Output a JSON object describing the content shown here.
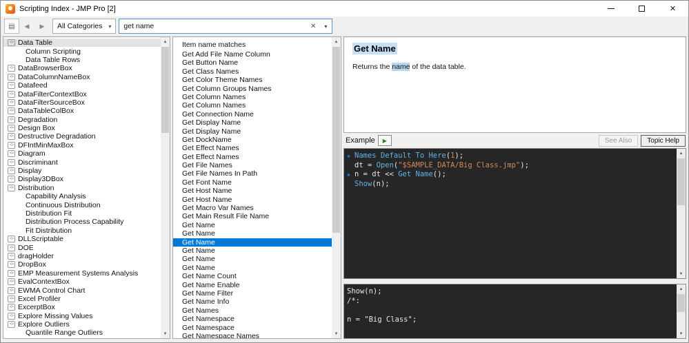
{
  "colors": {
    "selection": "#0078d7",
    "hl": "#b5d9f2",
    "hl-strong": "#c7e0f4",
    "code-bg": "#262626",
    "code-kw": "#5fb4ea",
    "code-str": "#d1885c",
    "code-num": "#d1885c",
    "marker": "#2f6fce"
  },
  "icons": {
    "up": "▲",
    "down": "▼",
    "back": "◀",
    "forward": "▶",
    "panel_toggle": "▤",
    "combo_arrow": "▾",
    "clear": "✕",
    "search_drop": "▾",
    "play": "▶",
    "tree_box": "<>",
    "marker": "◆",
    "close": "✕"
  },
  "window": {
    "title": "Scripting Index - JMP Pro [2]"
  },
  "toolbar": {
    "category_filter": {
      "value": "All Categories"
    },
    "search": {
      "value": "get name"
    }
  },
  "tree": {
    "items": [
      {
        "label": "Data Table",
        "icon": true,
        "indent": 0,
        "selected": true
      },
      {
        "label": "Column Scripting",
        "icon": false,
        "indent": 1
      },
      {
        "label": "Data Table Rows",
        "icon": false,
        "indent": 1
      },
      {
        "label": "DataBrowserBox",
        "icon": true,
        "indent": 0
      },
      {
        "label": "DataColumnNameBox",
        "icon": true,
        "indent": 0
      },
      {
        "label": "Datafeed",
        "icon": true,
        "indent": 0
      },
      {
        "label": "DataFilterContextBox",
        "icon": true,
        "indent": 0
      },
      {
        "label": "DataFilterSourceBox",
        "icon": true,
        "indent": 0
      },
      {
        "label": "DataTableColBox",
        "icon": true,
        "indent": 0
      },
      {
        "label": "Degradation",
        "icon": true,
        "indent": 0
      },
      {
        "label": "Design Box",
        "icon": true,
        "indent": 0
      },
      {
        "label": "Destructive Degradation",
        "icon": true,
        "indent": 0
      },
      {
        "label": "DFIntMinMaxBox",
        "icon": true,
        "indent": 0
      },
      {
        "label": "Diagram",
        "icon": true,
        "indent": 0
      },
      {
        "label": "Discriminant",
        "icon": true,
        "indent": 0
      },
      {
        "label": "Display",
        "icon": true,
        "indent": 0
      },
      {
        "label": "Display3DBox",
        "icon": true,
        "indent": 0
      },
      {
        "label": "Distribution",
        "icon": true,
        "indent": 0
      },
      {
        "label": "Capability Analysis",
        "icon": false,
        "indent": 1
      },
      {
        "label": "Continuous Distribution",
        "icon": false,
        "indent": 1
      },
      {
        "label": "Distribution Fit",
        "icon": false,
        "indent": 1
      },
      {
        "label": "Distribution Process Capability",
        "icon": false,
        "indent": 1
      },
      {
        "label": "Fit Distribution",
        "icon": false,
        "indent": 1
      },
      {
        "label": "DLLScriptable",
        "icon": true,
        "indent": 0
      },
      {
        "label": "DOE",
        "icon": true,
        "indent": 0
      },
      {
        "label": "dragHolder",
        "icon": true,
        "indent": 0
      },
      {
        "label": "DropBox",
        "icon": true,
        "indent": 0
      },
      {
        "label": "EMP Measurement Systems Analysis",
        "icon": true,
        "indent": 0
      },
      {
        "label": "EvalContextBox",
        "icon": true,
        "indent": 0
      },
      {
        "label": "EWMA Control Chart",
        "icon": true,
        "indent": 0
      },
      {
        "label": "Excel Profiler",
        "icon": true,
        "indent": 0
      },
      {
        "label": "ExcerptBox",
        "icon": true,
        "indent": 0
      },
      {
        "label": "Explore Missing Values",
        "icon": true,
        "indent": 0
      },
      {
        "label": "Explore Outliers",
        "icon": true,
        "indent": 0
      },
      {
        "label": "Quantile Range Outliers",
        "icon": false,
        "indent": 1
      }
    ]
  },
  "matches": {
    "header": "Item name matches",
    "selected_index": 22,
    "items": [
      "Get Add File Name Column",
      "Get Button Name",
      "Get Class Names",
      "Get Color Theme Names",
      "Get Column Groups Names",
      "Get Column Names",
      "Get Column Names",
      "Get Connection Name",
      "Get Display Name",
      "Get Display Name",
      "Get DockName",
      "Get Effect Names",
      "Get Effect Names",
      "Get File Names",
      "Get File Names In Path",
      "Get Font Name",
      "Get Host Name",
      "Get Host Name",
      "Get Macro Var Names",
      "Get Main Result File Name",
      "Get Name",
      "Get Name",
      "Get Name",
      "Get Name",
      "Get Name",
      "Get Name",
      "Get Name Count",
      "Get Name Enable",
      "Get Name Filter",
      "Get Name Info",
      "Get Names",
      "Get Namespace",
      "Get Namespace",
      "Get Namespace Names"
    ]
  },
  "detail": {
    "title": "Get Name",
    "description": [
      {
        "t": "Returns the "
      },
      {
        "t": "name",
        "hl": true
      },
      {
        "t": " of the data table."
      }
    ],
    "example_label": "Example",
    "buttons": {
      "see_also": "See Also",
      "topic_help": "Topic Help"
    },
    "code": {
      "lines": [
        {
          "marker": true,
          "tokens": [
            {
              "t": "Names Default To Here",
              "c": "kw"
            },
            {
              "t": "(",
              "c": ""
            },
            {
              "t": "1",
              "c": "num"
            },
            {
              "t": ");",
              "c": ""
            }
          ]
        },
        {
          "marker": false,
          "tokens": [
            {
              "t": "dt = ",
              "c": ""
            },
            {
              "t": "Open",
              "c": "kw"
            },
            {
              "t": "(",
              "c": ""
            },
            {
              "t": "\"$SAMPLE_DATA/Big Class.jmp\"",
              "c": "str"
            },
            {
              "t": ");",
              "c": ""
            }
          ]
        },
        {
          "marker": true,
          "tokens": [
            {
              "t": "n = dt << ",
              "c": ""
            },
            {
              "t": "Get Name",
              "c": "kw"
            },
            {
              "t": "();",
              "c": ""
            }
          ]
        },
        {
          "marker": false,
          "tokens": [
            {
              "t": "Show",
              "c": "kw"
            },
            {
              "t": "(n);",
              "c": ""
            }
          ]
        }
      ]
    },
    "log": {
      "lines": [
        "Show(n);",
        "/*:",
        "",
        "n = \"Big Class\";"
      ]
    }
  }
}
